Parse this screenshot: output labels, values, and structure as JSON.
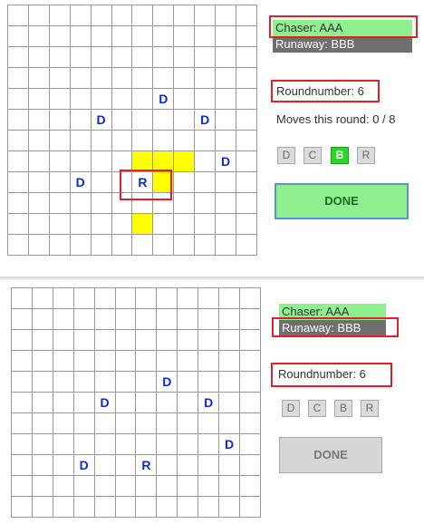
{
  "top_panel": {
    "chaser_label": "Chaser: AAA",
    "runaway_label": "Runaway: BBB",
    "round_label": "Roundnumber: 6",
    "moves_label": "Moves this round: 0 / 8",
    "buttons": [
      "D",
      "C",
      "B",
      "R"
    ],
    "active_button": "B",
    "done_label": "DONE",
    "board": {
      "rows": 12,
      "cols": 12,
      "pieces": [
        {
          "label": "D",
          "row": 4,
          "col": 7
        },
        {
          "label": "D",
          "row": 5,
          "col": 4
        },
        {
          "label": "D",
          "row": 5,
          "col": 9
        },
        {
          "label": "D",
          "row": 7,
          "col": 10
        },
        {
          "label": "D",
          "row": 8,
          "col": 3
        },
        {
          "label": "R",
          "row": 8,
          "col": 6
        }
      ],
      "highlighted_cells": [
        {
          "row": 7,
          "col": 6
        },
        {
          "row": 7,
          "col": 7
        },
        {
          "row": 7,
          "col": 8
        },
        {
          "row": 8,
          "col": 7
        },
        {
          "row": 10,
          "col": 6
        }
      ]
    }
  },
  "bottom_panel": {
    "chaser_label": "Chaser: AAA",
    "runaway_label": "Runaway: BBB",
    "round_label": "Roundnumber: 6",
    "buttons": [
      "D",
      "C",
      "B",
      "R"
    ],
    "done_label": "DONE",
    "board": {
      "rows": 11,
      "cols": 12,
      "pieces": [
        {
          "label": "D",
          "row": 4,
          "col": 7
        },
        {
          "label": "D",
          "row": 5,
          "col": 4
        },
        {
          "label": "D",
          "row": 5,
          "col": 9
        },
        {
          "label": "D",
          "row": 7,
          "col": 10
        },
        {
          "label": "D",
          "row": 8,
          "col": 3
        },
        {
          "label": "R",
          "row": 8,
          "col": 6
        }
      ],
      "highlighted_cells": []
    }
  },
  "colors": {
    "chaser_bg": "#8ef08e",
    "runaway_bg": "#6f6f6f",
    "highlight": "#ffff00",
    "outline": "#e0202a",
    "piece_text": "#0a2ae0",
    "active_button": "#27d827"
  }
}
